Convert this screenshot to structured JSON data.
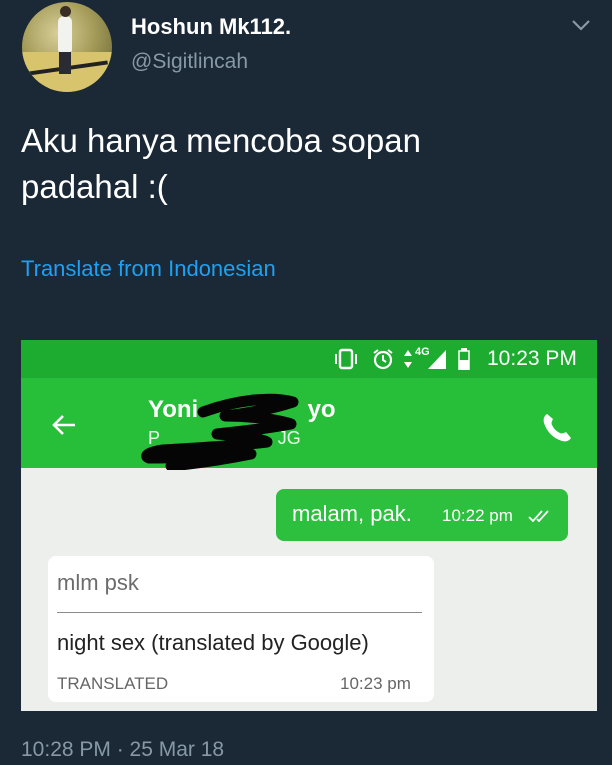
{
  "tweet": {
    "display_name": "Hoshun Mk112.",
    "handle": "@Sigitlincah",
    "text": "Aku hanya mencoba sopan\npadahal :(",
    "translate_link": "Translate from Indonesian",
    "timestamp": "10:28 PM · 25 Mar 18"
  },
  "embedded_screenshot": {
    "statusbar": {
      "time": "10:23 PM",
      "network": "4G",
      "icons": [
        "vibrate-icon",
        "alarm-icon",
        "data-arrows-icon",
        "signal-icon",
        "battery-icon"
      ]
    },
    "toolbar": {
      "contact_name_visible": "Yoni",
      "contact_name_tail": "yo",
      "contact_sub_visible": "P",
      "contact_sub_tail": "JG",
      "icons": [
        "back-arrow-icon",
        "phone-icon"
      ]
    },
    "messages": [
      {
        "direction": "outgoing",
        "text": "malam, pak.",
        "time": "10:22 pm",
        "status": "double-check-icon"
      },
      {
        "direction": "incoming",
        "original": "mlm psk",
        "translated": "night sex (translated by Google)",
        "label": "TRANSLATED",
        "time": "10:23 pm"
      }
    ]
  },
  "colors": {
    "background": "#1b2836",
    "link": "#1da1f2",
    "muted": "#8899a6",
    "statusbar": "#1eac30",
    "toolbar": "#27bf3a",
    "bubble_out": "#2dc03f",
    "chat_bg": "#ecefec"
  }
}
